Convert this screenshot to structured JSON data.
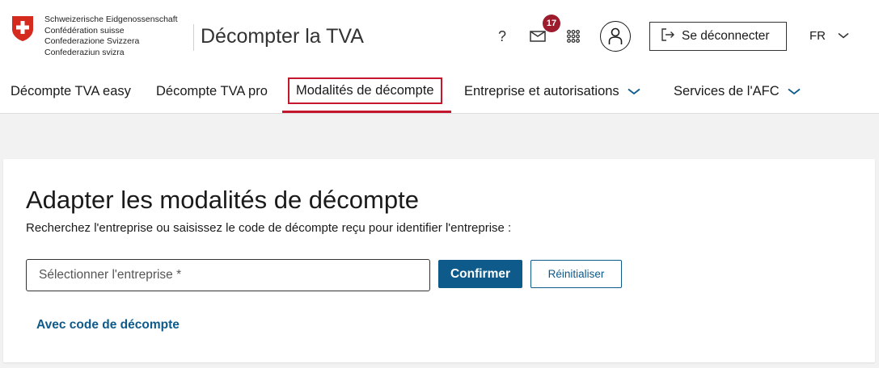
{
  "header": {
    "federation_lines": [
      "Schweizerische Eidgenossenschaft",
      "Confédération suisse",
      "Confederazione Svizzera",
      "Confederaziun svizra"
    ],
    "app_title": "Décompter la TVA",
    "help_label": "?",
    "notifications_count": "17",
    "logout_label": "Se déconnecter",
    "language": "FR",
    "colors": {
      "badge": "#9c1b2c",
      "logo_red": "#d52b1e"
    }
  },
  "nav": {
    "items": [
      {
        "label": "Décompte TVA easy",
        "active": false,
        "has_dropdown": false
      },
      {
        "label": "Décompte TVA pro",
        "active": false,
        "has_dropdown": false
      },
      {
        "label": "Modalités de décompte",
        "active": true,
        "has_dropdown": false
      },
      {
        "label": "Entreprise et autorisations",
        "active": false,
        "has_dropdown": true
      },
      {
        "label": "Services de l'AFC",
        "active": false,
        "has_dropdown": true
      }
    ],
    "active_color": "#c4172e"
  },
  "main": {
    "title": "Adapter les modalités de décompte",
    "description": "Recherchez l'entreprise ou saisissez le code de décompte reçu pour identifier l'entreprise :",
    "company_input": {
      "placeholder": "Sélectionner l'entreprise *",
      "value": ""
    },
    "confirm_label": "Confirmer",
    "reset_label": "Réinitialiser",
    "code_link_label": "Avec code de décompte",
    "accent": "#0e5a8a"
  }
}
